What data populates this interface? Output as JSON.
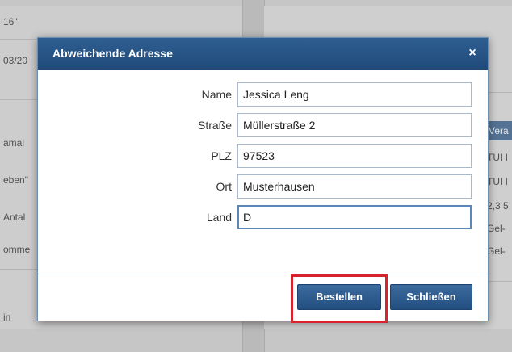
{
  "background": {
    "left_texts": [
      "16\"",
      "03/20",
      "amal",
      "eben\"",
      "Antal",
      "omme",
      "in"
    ],
    "right_header": "Vera",
    "right_texts": [
      "TUI I",
      "TUI I",
      "2,3 5",
      "Gel-",
      "Gel-"
    ]
  },
  "dialog": {
    "title": "Abweichende Adresse",
    "close_glyph": "×",
    "fields": [
      {
        "label": "Name",
        "value": "Jessica Leng"
      },
      {
        "label": "Straße",
        "value": "Müllerstraße 2"
      },
      {
        "label": "PLZ",
        "value": "97523"
      },
      {
        "label": "Ort",
        "value": "Musterhausen"
      },
      {
        "label": "Land",
        "value": "D"
      }
    ],
    "buttons": {
      "order": "Bestellen",
      "close": "Schließen"
    }
  },
  "colors": {
    "header": "#2a5889",
    "button": "#2e5d90",
    "highlight": "#d8232f"
  }
}
